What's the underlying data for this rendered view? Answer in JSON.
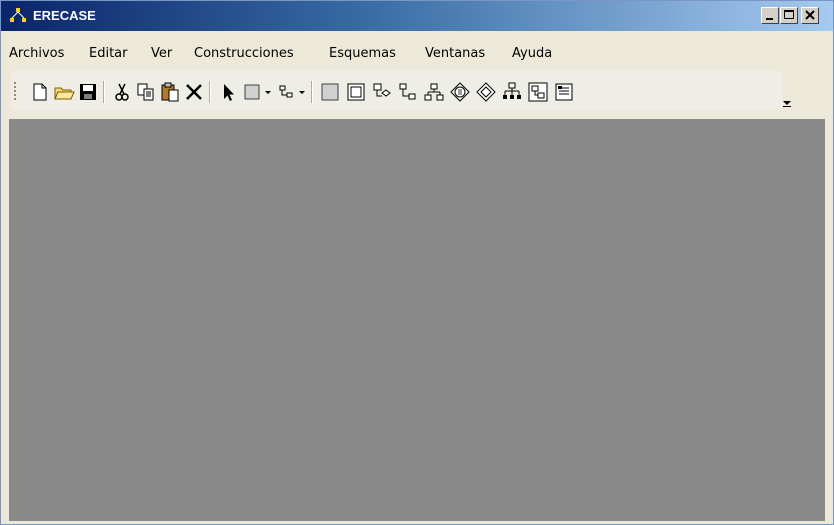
{
  "window": {
    "title": "ERECASE",
    "controls": {
      "minimize": "minimize-icon",
      "maximize": "maximize-icon",
      "close": "close-icon"
    }
  },
  "menu": {
    "items": [
      "Archivos",
      "Editar",
      "Ver",
      "Construcciones",
      "Esquemas",
      "Ventanas",
      "Ayuda"
    ]
  },
  "toolbar": {
    "icons": [
      "new-document-icon",
      "open-folder-icon",
      "save-icon",
      "cut-icon",
      "copy-icon",
      "paste-icon",
      "delete-icon",
      "pointer-icon",
      "entity-shape-dropdown-icon",
      "relation-shape-dropdown-icon",
      "entity-icon",
      "weak-entity-icon",
      "relationship-icon",
      "relationship-link-icon",
      "hierarchy-icon",
      "isa-icon",
      "weak-relationship-icon",
      "aggregation-icon",
      "attribute-icon",
      "properties-icon"
    ]
  },
  "colors": {
    "title_gradient_start": "#0a246a",
    "title_gradient_end": "#a6caf0",
    "workspace": "#898989",
    "chrome": "#ece9d8"
  }
}
